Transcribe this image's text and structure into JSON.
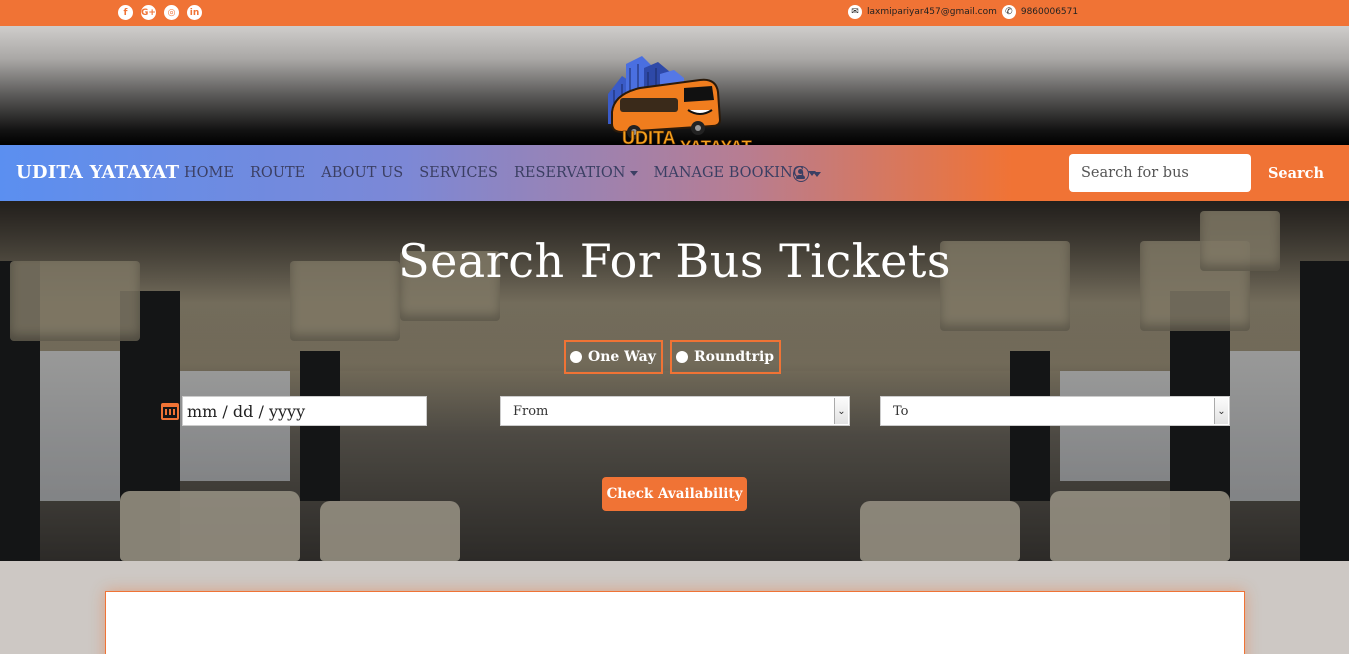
{
  "topbar": {
    "social": [
      {
        "icon": "facebook-icon",
        "glyph": "f"
      },
      {
        "icon": "google-plus-icon",
        "glyph": "G+"
      },
      {
        "icon": "instagram-icon",
        "glyph": "◎"
      },
      {
        "icon": "linkedin-icon",
        "glyph": "in"
      }
    ],
    "email": "laxmipariyar457@gmail.com",
    "phone": "9860006571"
  },
  "logo": {
    "text_top": "UDITA",
    "text_bottom": "YATAYAT"
  },
  "nav": {
    "brand": "UDITA YATAYAT",
    "links": [
      "HOME",
      "ROUTE",
      "ABOUT US",
      "SERVICES",
      "RESERVATION",
      "MANAGE BOOKING"
    ],
    "search_placeholder": "Search for bus",
    "search_button": "Search"
  },
  "hero": {
    "title": "Search For Bus Tickets",
    "trip_options": [
      "One Way",
      "Roundtrip"
    ],
    "date_placeholder": "mm / dd / yyyy",
    "from_selected": "From",
    "to_selected": "To",
    "check_button": "Check Availability"
  },
  "colors": {
    "accent": "#f07335",
    "nav_start": "#5b8ff0",
    "nav_text": "#3b3f63"
  }
}
